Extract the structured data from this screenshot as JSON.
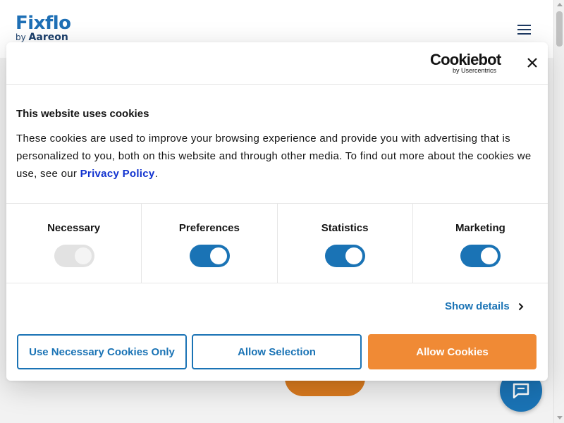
{
  "site": {
    "logo_text": "Fixflo",
    "logo_sub_prefix": "by",
    "logo_sub_brand": "Aareon",
    "menu_icon": "hamburger-icon",
    "chat_icon": "chat-icon"
  },
  "dialog": {
    "brand_word": "Cookiebot",
    "brand_sub": "by Usercentrics",
    "close_icon": "close-icon",
    "title": "This website uses cookies",
    "description_before": "These cookies are used to improve your browsing experience and provide you with advertising that is personalized to you, both on this website and through other media. To find out more about the cookies we use, see our ",
    "privacy_link": "Privacy Policy",
    "description_after": ".",
    "categories": [
      {
        "label": "Necessary",
        "enabled": true,
        "disabled": true
      },
      {
        "label": "Preferences",
        "enabled": true,
        "disabled": false
      },
      {
        "label": "Statistics",
        "enabled": true,
        "disabled": false
      },
      {
        "label": "Marketing",
        "enabled": true,
        "disabled": false
      }
    ],
    "show_details": "Show details",
    "buttons": {
      "necessary_only": "Use Necessary Cookies Only",
      "allow_selection": "Allow Selection",
      "allow_all": "Allow Cookies"
    }
  },
  "colors": {
    "primary_blue": "#1a73b5",
    "allow_orange": "#f08a35",
    "link_blue": "#1032cf"
  }
}
